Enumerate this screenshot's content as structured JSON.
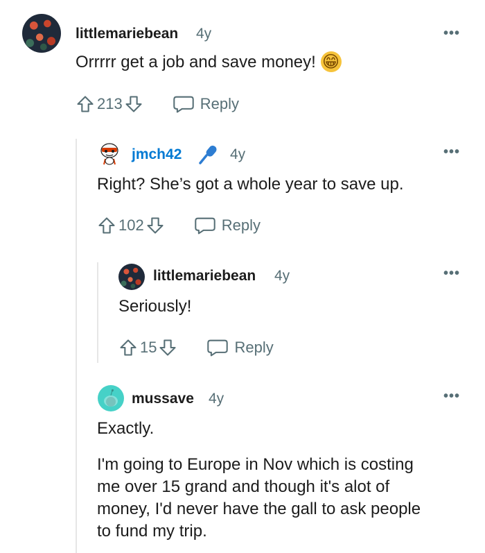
{
  "comments": [
    {
      "username": "littlemariebean",
      "age": "4y",
      "text": "Orrrrr get a job and save money!",
      "emoji": "😁",
      "votes": "213",
      "reply_label": "Reply"
    },
    {
      "username": "jmch42",
      "age": "4y",
      "text": "Right? She’s got a whole year to save up.",
      "votes": "102",
      "reply_label": "Reply"
    },
    {
      "username": "littlemariebean",
      "age": "4y",
      "text": "Seriously!",
      "votes": "15",
      "reply_label": "Reply"
    },
    {
      "username": "mussave",
      "age": "4y",
      "paragraphs": [
        "Exactly.",
        "I'm going to Europe in Nov which is costing",
        "me over 15 grand and though it's alot of",
        "money, I'd never have the gall to ask people",
        "to fund my trip."
      ]
    }
  ],
  "more_label": "•••",
  "icons": {
    "upvote": "upvote-arrow-icon",
    "downvote": "downvote-arrow-icon",
    "reply": "speech-bubble-icon",
    "microphone": "microphone-icon"
  }
}
